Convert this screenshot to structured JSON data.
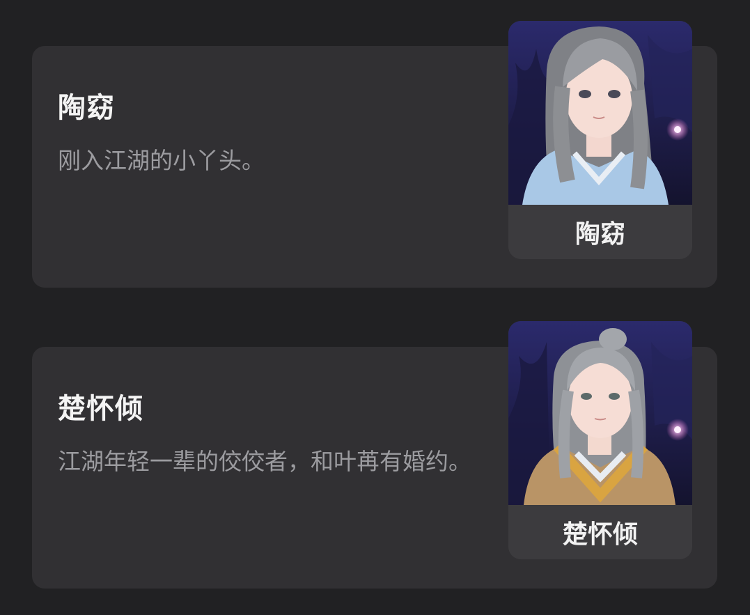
{
  "characters": [
    {
      "name": "陶窈",
      "description": "刚入江湖的小丫头。",
      "portrait_label": "陶窈",
      "portrait_icon": "female-character-portrait",
      "colors": {
        "robe": "#a9c8e6",
        "hair": "#8d8f93",
        "background": "#1e1d4a"
      }
    },
    {
      "name": "楚怀倾",
      "description": "江湖年轻一辈的佼佼者，和叶苒有婚约。",
      "portrait_label": "楚怀倾",
      "portrait_icon": "male-character-portrait",
      "colors": {
        "robe": "#d9a441",
        "hair": "#9ea1a6",
        "background": "#1e1d4a"
      }
    }
  ],
  "theme": {
    "page_background": "#212123",
    "card_background": "#313033",
    "portrait_label_background": "#3c3b3e",
    "name_color": "#f4f4f4",
    "description_color": "#9c9ca0"
  }
}
